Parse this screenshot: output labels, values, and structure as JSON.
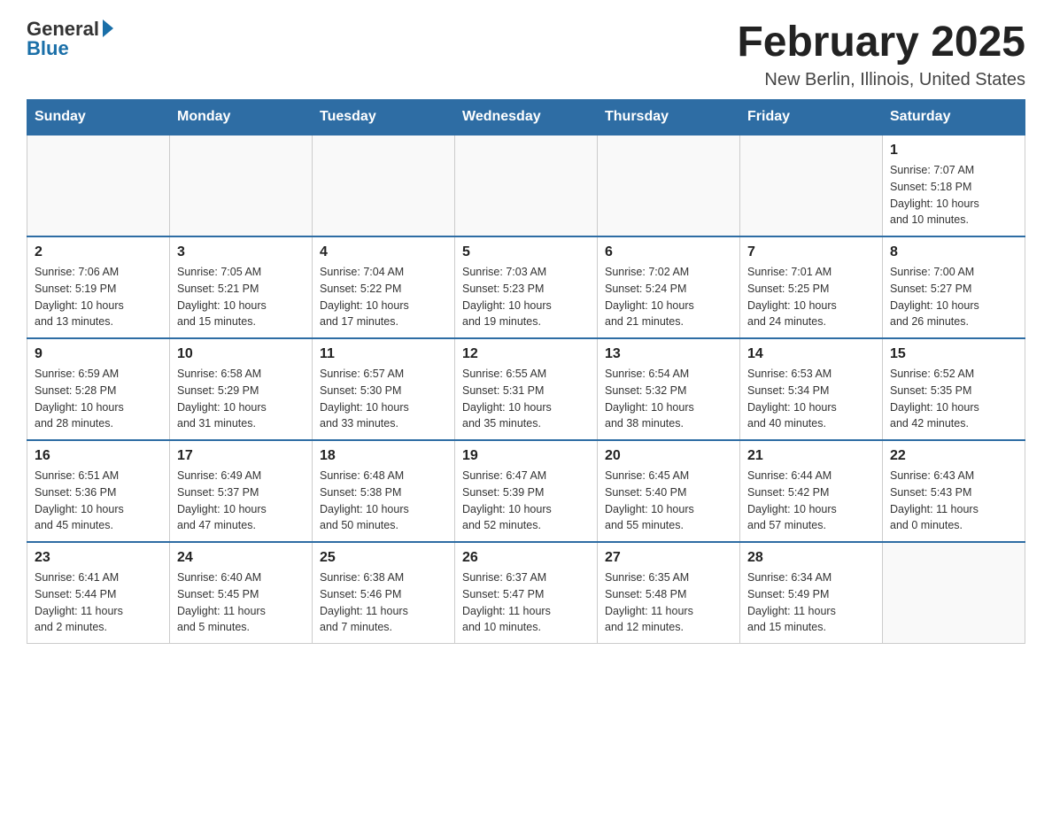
{
  "header": {
    "logo_general": "General",
    "logo_blue": "Blue",
    "title": "February 2025",
    "subtitle": "New Berlin, Illinois, United States"
  },
  "weekdays": [
    "Sunday",
    "Monday",
    "Tuesday",
    "Wednesday",
    "Thursday",
    "Friday",
    "Saturday"
  ],
  "weeks": [
    [
      {
        "day": "",
        "info": ""
      },
      {
        "day": "",
        "info": ""
      },
      {
        "day": "",
        "info": ""
      },
      {
        "day": "",
        "info": ""
      },
      {
        "day": "",
        "info": ""
      },
      {
        "day": "",
        "info": ""
      },
      {
        "day": "1",
        "info": "Sunrise: 7:07 AM\nSunset: 5:18 PM\nDaylight: 10 hours\nand 10 minutes."
      }
    ],
    [
      {
        "day": "2",
        "info": "Sunrise: 7:06 AM\nSunset: 5:19 PM\nDaylight: 10 hours\nand 13 minutes."
      },
      {
        "day": "3",
        "info": "Sunrise: 7:05 AM\nSunset: 5:21 PM\nDaylight: 10 hours\nand 15 minutes."
      },
      {
        "day": "4",
        "info": "Sunrise: 7:04 AM\nSunset: 5:22 PM\nDaylight: 10 hours\nand 17 minutes."
      },
      {
        "day": "5",
        "info": "Sunrise: 7:03 AM\nSunset: 5:23 PM\nDaylight: 10 hours\nand 19 minutes."
      },
      {
        "day": "6",
        "info": "Sunrise: 7:02 AM\nSunset: 5:24 PM\nDaylight: 10 hours\nand 21 minutes."
      },
      {
        "day": "7",
        "info": "Sunrise: 7:01 AM\nSunset: 5:25 PM\nDaylight: 10 hours\nand 24 minutes."
      },
      {
        "day": "8",
        "info": "Sunrise: 7:00 AM\nSunset: 5:27 PM\nDaylight: 10 hours\nand 26 minutes."
      }
    ],
    [
      {
        "day": "9",
        "info": "Sunrise: 6:59 AM\nSunset: 5:28 PM\nDaylight: 10 hours\nand 28 minutes."
      },
      {
        "day": "10",
        "info": "Sunrise: 6:58 AM\nSunset: 5:29 PM\nDaylight: 10 hours\nand 31 minutes."
      },
      {
        "day": "11",
        "info": "Sunrise: 6:57 AM\nSunset: 5:30 PM\nDaylight: 10 hours\nand 33 minutes."
      },
      {
        "day": "12",
        "info": "Sunrise: 6:55 AM\nSunset: 5:31 PM\nDaylight: 10 hours\nand 35 minutes."
      },
      {
        "day": "13",
        "info": "Sunrise: 6:54 AM\nSunset: 5:32 PM\nDaylight: 10 hours\nand 38 minutes."
      },
      {
        "day": "14",
        "info": "Sunrise: 6:53 AM\nSunset: 5:34 PM\nDaylight: 10 hours\nand 40 minutes."
      },
      {
        "day": "15",
        "info": "Sunrise: 6:52 AM\nSunset: 5:35 PM\nDaylight: 10 hours\nand 42 minutes."
      }
    ],
    [
      {
        "day": "16",
        "info": "Sunrise: 6:51 AM\nSunset: 5:36 PM\nDaylight: 10 hours\nand 45 minutes."
      },
      {
        "day": "17",
        "info": "Sunrise: 6:49 AM\nSunset: 5:37 PM\nDaylight: 10 hours\nand 47 minutes."
      },
      {
        "day": "18",
        "info": "Sunrise: 6:48 AM\nSunset: 5:38 PM\nDaylight: 10 hours\nand 50 minutes."
      },
      {
        "day": "19",
        "info": "Sunrise: 6:47 AM\nSunset: 5:39 PM\nDaylight: 10 hours\nand 52 minutes."
      },
      {
        "day": "20",
        "info": "Sunrise: 6:45 AM\nSunset: 5:40 PM\nDaylight: 10 hours\nand 55 minutes."
      },
      {
        "day": "21",
        "info": "Sunrise: 6:44 AM\nSunset: 5:42 PM\nDaylight: 10 hours\nand 57 minutes."
      },
      {
        "day": "22",
        "info": "Sunrise: 6:43 AM\nSunset: 5:43 PM\nDaylight: 11 hours\nand 0 minutes."
      }
    ],
    [
      {
        "day": "23",
        "info": "Sunrise: 6:41 AM\nSunset: 5:44 PM\nDaylight: 11 hours\nand 2 minutes."
      },
      {
        "day": "24",
        "info": "Sunrise: 6:40 AM\nSunset: 5:45 PM\nDaylight: 11 hours\nand 5 minutes."
      },
      {
        "day": "25",
        "info": "Sunrise: 6:38 AM\nSunset: 5:46 PM\nDaylight: 11 hours\nand 7 minutes."
      },
      {
        "day": "26",
        "info": "Sunrise: 6:37 AM\nSunset: 5:47 PM\nDaylight: 11 hours\nand 10 minutes."
      },
      {
        "day": "27",
        "info": "Sunrise: 6:35 AM\nSunset: 5:48 PM\nDaylight: 11 hours\nand 12 minutes."
      },
      {
        "day": "28",
        "info": "Sunrise: 6:34 AM\nSunset: 5:49 PM\nDaylight: 11 hours\nand 15 minutes."
      },
      {
        "day": "",
        "info": ""
      }
    ]
  ]
}
